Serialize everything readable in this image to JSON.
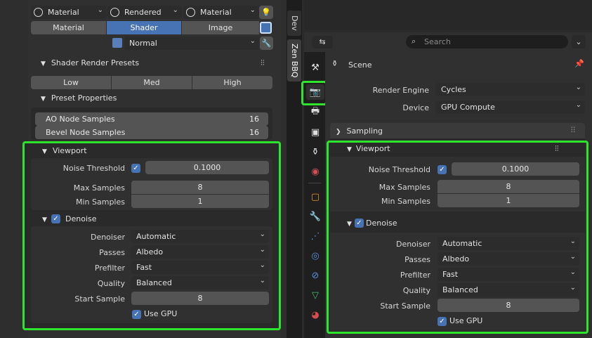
{
  "left": {
    "top_dropdowns": [
      "Material",
      "Rendered",
      "Material"
    ],
    "tabs": [
      "Material",
      "Shader",
      "Image"
    ],
    "normal": "Normal",
    "presets_title": "Shader Render Presets",
    "preset_buttons": [
      "Low",
      "Med",
      "High"
    ],
    "preset_props_title": "Preset Properties",
    "ao_label": "AO Node Samples",
    "ao_value": "16",
    "bevel_label": "Bevel Node Samples",
    "bevel_value": "16",
    "viewport_title": "Viewport",
    "noise_label": "Noise Threshold",
    "noise_value": "0.1000",
    "max_label": "Max Samples",
    "max_value": "8",
    "min_label": "Min Samples",
    "min_value": "1",
    "denoise_title": "Denoise",
    "denoiser_label": "Denoiser",
    "denoiser_value": "Automatic",
    "passes_label": "Passes",
    "passes_value": "Albedo",
    "prefilter_label": "Prefilter",
    "prefilter_value": "Fast",
    "quality_label": "Quality",
    "quality_value": "Balanced",
    "start_label": "Start Sample",
    "start_value": "8",
    "gpu_label": "Use GPU"
  },
  "sidetabs": [
    "Dev",
    "Zen BBQ"
  ],
  "right": {
    "search_placeholder": "Search",
    "scene": "Scene",
    "engine_label": "Render Engine",
    "engine_value": "Cycles",
    "device_label": "Device",
    "device_value": "GPU Compute",
    "sampling_title": "Sampling",
    "viewport_title": "Viewport",
    "noise_label": "Noise Threshold",
    "noise_value": "0.1000",
    "max_label": "Max Samples",
    "max_value": "8",
    "min_label": "Min Samples",
    "min_value": "1",
    "denoise_title": "Denoise",
    "denoiser_label": "Denoiser",
    "denoiser_value": "Automatic",
    "passes_label": "Passes",
    "passes_value": "Albedo",
    "prefilter_label": "Prefilter",
    "prefilter_value": "Fast",
    "quality_label": "Quality",
    "quality_value": "Balanced",
    "start_label": "Start Sample",
    "start_value": "8",
    "gpu_label": "Use GPU"
  },
  "colors": {
    "highlight": "#2ee52e",
    "accent": "#4772b3"
  }
}
